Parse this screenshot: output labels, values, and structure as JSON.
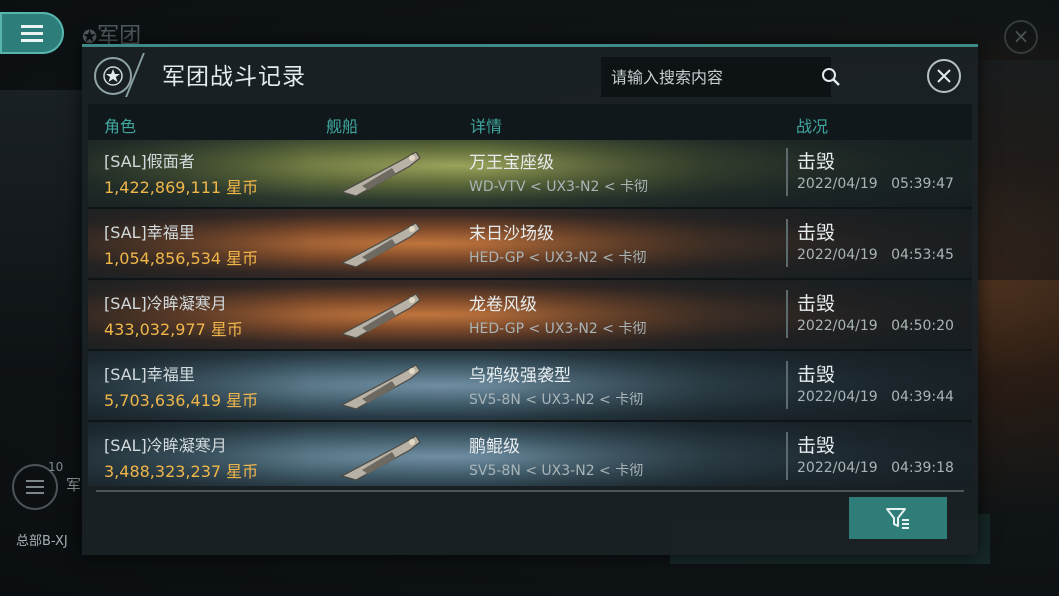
{
  "background": {
    "title": "军团",
    "side_count": "10",
    "side_label": "军",
    "hq_label": "总部B-XJ"
  },
  "panel": {
    "title": "军团战斗记录",
    "search_placeholder": "请输入搜索内容",
    "columns": [
      "角色",
      "舰船",
      "详情",
      "战况"
    ]
  },
  "records": [
    {
      "name": "[SAL]假面者",
      "value": "1,422,869,111 星币",
      "ship_class": "万王宝座级",
      "route": "WD-VTV < UX3-N2 < 卡彻",
      "status": "击毁",
      "date": "2022/04/19",
      "time": "05:39:47",
      "theme": "green"
    },
    {
      "name": "[SAL]幸福里",
      "value": "1,054,856,534 星币",
      "ship_class": "末日沙场级",
      "route": "HED-GP < UX3-N2 < 卡彻",
      "status": "击毁",
      "date": "2022/04/19",
      "time": "04:53:45",
      "theme": "orange"
    },
    {
      "name": "[SAL]冷眸凝寒月",
      "value": "433,032,977 星币",
      "ship_class": "龙卷风级",
      "route": "HED-GP < UX3-N2 < 卡彻",
      "status": "击毁",
      "date": "2022/04/19",
      "time": "04:50:20",
      "theme": "orange"
    },
    {
      "name": "[SAL]幸福里",
      "value": "5,703,636,419 星币",
      "ship_class": "乌鸦级强袭型",
      "route": "SV5-8N < UX3-N2 < 卡彻",
      "status": "击毁",
      "date": "2022/04/19",
      "time": "04:39:44",
      "theme": "blue"
    },
    {
      "name": "[SAL]冷眸凝寒月",
      "value": "3,488,323,237 星币",
      "ship_class": "鹏鲲级",
      "route": "SV5-8N < UX3-N2 < 卡彻",
      "status": "击毁",
      "date": "2022/04/19",
      "time": "04:39:18",
      "theme": "blue"
    }
  ],
  "colors": {
    "accent": "#3fa7a0",
    "value_gold": "#f0b64a",
    "button_teal": "#2f7d78"
  },
  "icons": {
    "menu": "hamburger-icon",
    "emblem": "star-emblem-icon",
    "search": "search-icon",
    "close": "close-icon",
    "filter": "filter-icon"
  }
}
